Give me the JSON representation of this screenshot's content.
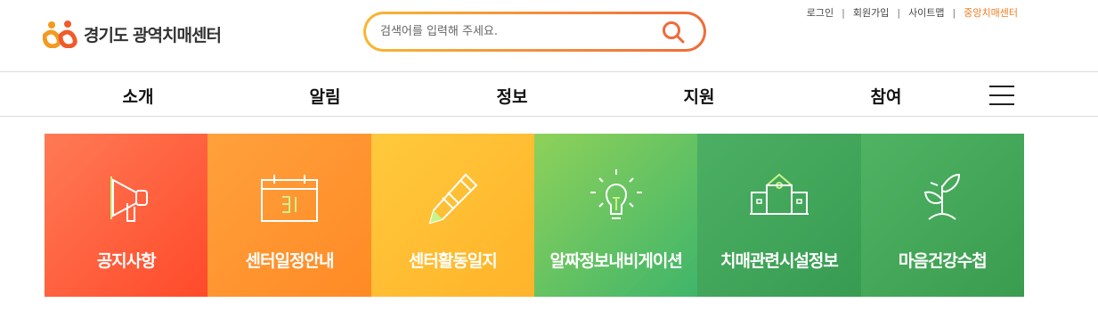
{
  "header": {
    "logo_text": "경기도 광역치매센터",
    "search": {
      "placeholder": "검색어를 입력해 주세요."
    },
    "util_links": [
      "로그인",
      "회원가입",
      "사이트맵",
      "중앙치매센터"
    ]
  },
  "nav": {
    "items": [
      "소개",
      "알림",
      "정보",
      "지원",
      "참여"
    ]
  },
  "tiles": [
    {
      "label": "공지사항",
      "icon": "megaphone-icon",
      "colors": [
        "#ff7a55",
        "#ff4a2a"
      ]
    },
    {
      "label": "센터일정안내",
      "icon": "calendar-icon",
      "colors": [
        "#ffa13c",
        "#ff8a25"
      ]
    },
    {
      "label": "센터활동일지",
      "icon": "pencil-icon",
      "colors": [
        "#ffc93c",
        "#ffb32a"
      ]
    },
    {
      "label": "알짜정보내비게이션",
      "icon": "lightbulb-icon",
      "colors": [
        "#8ed15a",
        "#3fb56a"
      ]
    },
    {
      "label": "치매관련시설정보",
      "icon": "building-icon",
      "colors": [
        "#4caf63",
        "#379c52"
      ]
    },
    {
      "label": "마음건강수첩",
      "icon": "sprout-icon",
      "colors": [
        "#4fb364",
        "#3a9c4e"
      ]
    }
  ],
  "colors": {
    "accent_orange": "#ef7d22",
    "tile_icon_highlight": "#a8e06a"
  }
}
